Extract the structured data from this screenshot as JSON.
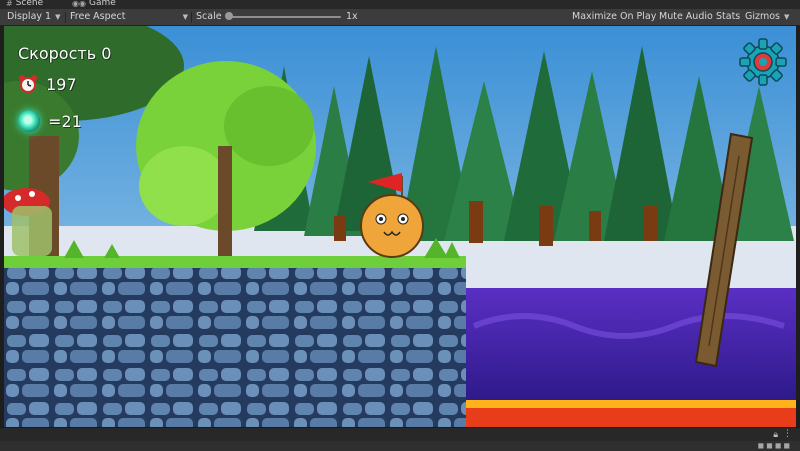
{
  "editor": {
    "tabs": [
      {
        "label": "Scene",
        "icon": "hash-icon"
      },
      {
        "label": "Game",
        "icon": "gamepad-icon"
      }
    ]
  },
  "toolbar": {
    "display": "Display 1",
    "aspect": "Free Aspect",
    "scale_label": "Scale",
    "scale_value": "1x",
    "maximize_on_play": "Maximize On Play",
    "mute_audio": "Mute Audio",
    "stats": "Stats",
    "gizmos": "Gizmos"
  },
  "hud": {
    "speed": "Скорость 0",
    "timer": "197",
    "gems": "=21"
  },
  "colors": {
    "grass": "#6fcf3a",
    "stone": "#5d7fa6",
    "water": "#4b2bb0",
    "lava": "#e83d1a",
    "ball": "#f0a53a",
    "flag": "#e02424",
    "settings_gear": "#1aa3b8"
  }
}
